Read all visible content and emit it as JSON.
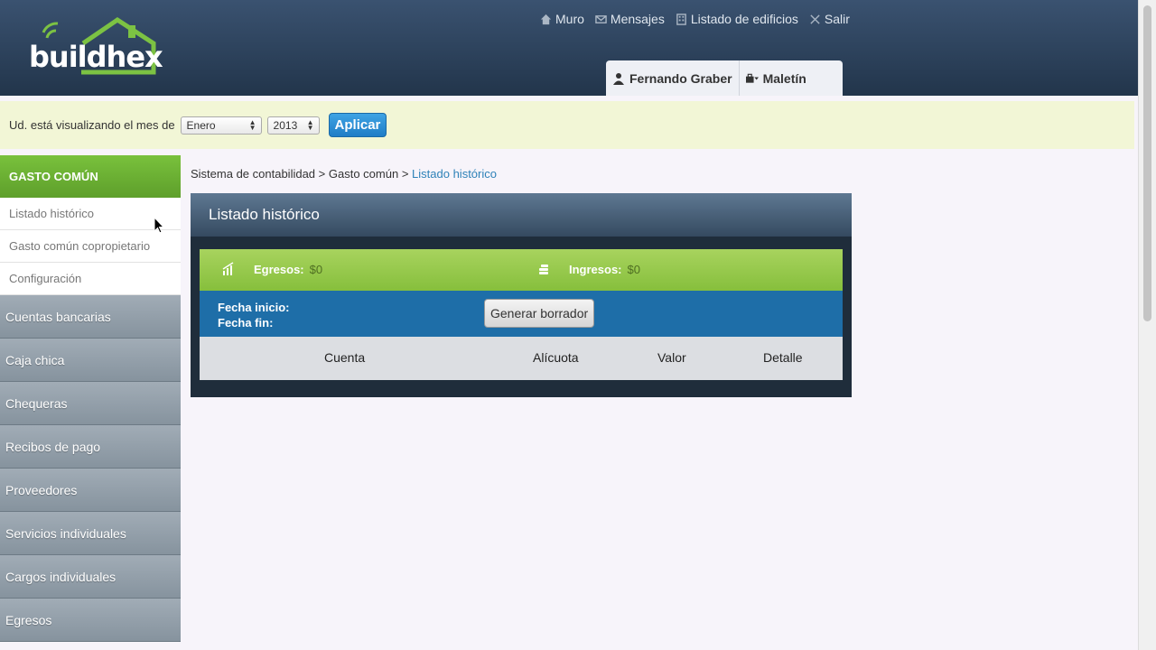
{
  "header": {
    "logo": {
      "part1": "build",
      "part2": "hex"
    },
    "nav": [
      {
        "label": "Muro",
        "icon": "home-icon"
      },
      {
        "label": "Mensajes",
        "icon": "envelope-icon"
      },
      {
        "label": "Listado de edificios",
        "icon": "building-icon"
      },
      {
        "label": "Salir",
        "icon": "close-icon"
      }
    ],
    "user_tabs": [
      {
        "label": "Fernando Graber",
        "icon": "user-icon"
      },
      {
        "label": "Maletín",
        "icon": "briefcase-icon"
      }
    ]
  },
  "filter": {
    "prefix": "Ud. está visualizando el mes de",
    "month": "Enero",
    "year": "2013",
    "apply_label": "Aplicar"
  },
  "sidebar": {
    "section": "GASTO COMÚN",
    "subitems": [
      "Listado histórico",
      "Gasto común copropietario",
      "Configuración"
    ],
    "items": [
      "Cuentas bancarias",
      "Caja chica",
      "Chequeras",
      "Recibos de pago",
      "Proveedores",
      "Servicios individuales",
      "Cargos individuales",
      "Egresos"
    ]
  },
  "breadcrumb": {
    "part1": "Sistema de contabilidad",
    "part2": "Gasto común",
    "current": "Listado histórico",
    "sep": ">"
  },
  "panel": {
    "title": "Listado histórico",
    "egresos_label": "Egresos:",
    "egresos_value": "$0",
    "ingresos_label": "Ingresos:",
    "ingresos_value": "$0",
    "fecha_inicio": "Fecha inicio:",
    "fecha_fin": "Fecha fin:",
    "generate_label": "Generar borrador",
    "columns": [
      "Cuenta",
      "Alícuota",
      "Valor",
      "Detalle"
    ]
  },
  "colors": {
    "accent_green": "#6fb33a",
    "header_dark": "#2a3e55",
    "link_blue": "#2f82b8",
    "dates_blue": "#1e6ea8"
  }
}
